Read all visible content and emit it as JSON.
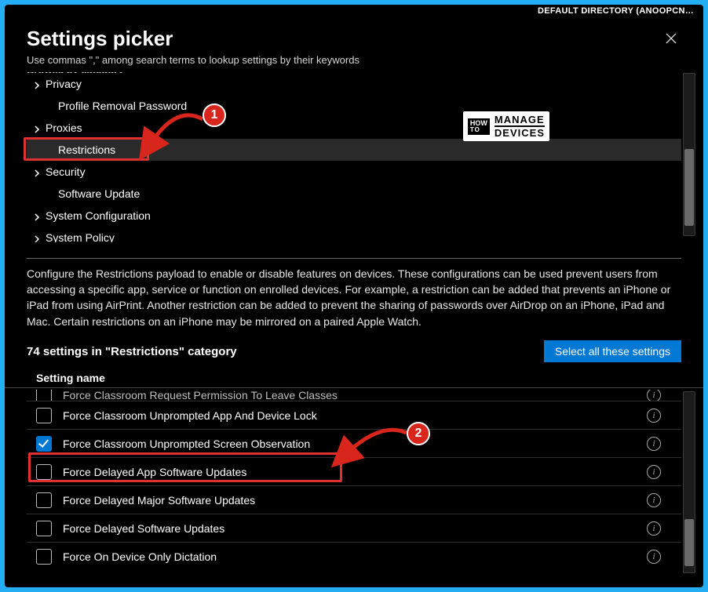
{
  "topbar": {
    "directory": "DEFAULT DIRECTORY (ANOOPCN…"
  },
  "header": {
    "title": "Settings picker",
    "subtitle": "Use commas \",\" among search terms to lookup settings by their keywords"
  },
  "browse_label": "Browse by category",
  "categories": [
    {
      "label": "Privacy",
      "expandable": true,
      "child": false
    },
    {
      "label": "Profile Removal Password",
      "expandable": false,
      "child": true
    },
    {
      "label": "Proxies",
      "expandable": true,
      "child": false
    },
    {
      "label": "Restrictions",
      "expandable": false,
      "child": true,
      "selected": true
    },
    {
      "label": "Security",
      "expandable": true,
      "child": false
    },
    {
      "label": "Software Update",
      "expandable": false,
      "child": true
    },
    {
      "label": "System Configuration",
      "expandable": true,
      "child": false
    },
    {
      "label": "System Policy",
      "expandable": true,
      "child": false
    }
  ],
  "description": "Configure the Restrictions payload to enable or disable features on devices. These configurations can be used prevent users from accessing a specific app, service or function on enrolled devices. For example, a restriction can be added that prevents an iPhone or iPad from using AirPrint. Another restriction can be added to prevent the sharing of passwords over AirDrop on an iPhone, iPad and Mac. Certain restrictions on an iPhone may be mirrored on a paired Apple Watch.",
  "count_text": "74 settings in \"Restrictions\" category",
  "select_all": "Select all these settings",
  "column_header": "Setting name",
  "cutoff_setting": "Force Classroom Request Permission To Leave Classes",
  "settings": [
    {
      "label": "Force Classroom Unprompted App And Device Lock",
      "checked": false
    },
    {
      "label": "Force Classroom Unprompted Screen Observation",
      "checked": true
    },
    {
      "label": "Force Delayed App Software Updates",
      "checked": false
    },
    {
      "label": "Force Delayed Major Software Updates",
      "checked": false
    },
    {
      "label": "Force Delayed Software Updates",
      "checked": false
    },
    {
      "label": "Force On Device Only Dictation",
      "checked": false
    }
  ],
  "annotations": {
    "badge1": "1",
    "badge2": "2"
  },
  "logo": {
    "how": "HOW",
    "to": "TO",
    "line1": "MANAGE",
    "line2": "DEVICES"
  }
}
